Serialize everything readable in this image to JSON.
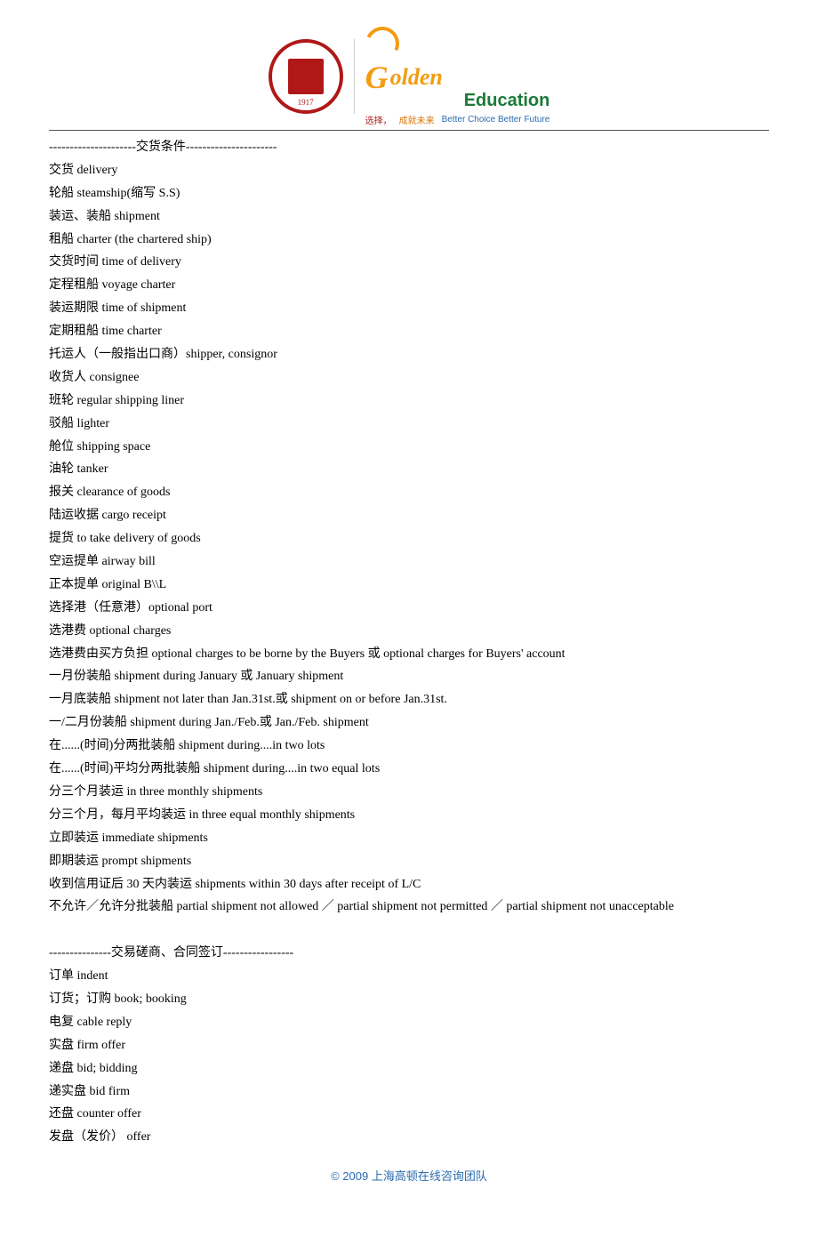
{
  "header": {
    "brand_g": "G",
    "brand_rest": "olden",
    "brand_sub": "Education",
    "tagline_cn1": "选择，",
    "tagline_cn2": "成就未来",
    "tagline_en": "Better Choice  Better Future",
    "seal_year": "1917"
  },
  "sections": [
    {
      "title": "---------------------交货条件----------------------",
      "lines": [
        "交货 delivery",
        "轮船 steamship(缩写 S.S)",
        "装运、装船 shipment",
        "租船 charter (the chartered ship)",
        "交货时间  time of delivery",
        "定程租船 voyage charter",
        "装运期限 time of shipment",
        "定期租船 time charter",
        "托运人（一般指出口商）shipper, consignor",
        "收货人 consignee",
        "班轮 regular shipping liner",
        "驳船 lighter",
        "舱位 shipping space",
        "油轮 tanker",
        "报关 clearance of goods",
        "陆运收据 cargo receipt",
        "提货 to take delivery of goods",
        "空运提单 airway bill",
        "正本提单 original B\\\\L",
        "选择港（任意港）optional port",
        "选港费 optional charges",
        "选港费由买方负担  optional charges to be borne by the Buyers  或  optional charges for Buyers'   account",
        "一月份装船  shipment during January  或  January shipment",
        "一月底装船  shipment not later than Jan.31st.或 shipment on or before Jan.31st.",
        "一/二月份装船  shipment during Jan./Feb.或  Jan./Feb. shipment",
        "在......(时间)分两批装船  shipment during....in two lots",
        "在......(时间)平均分两批装船  shipment during....in two equal lots",
        "分三个月装运  in three monthly shipments",
        "分三个月，每月平均装运  in three equal monthly shipments",
        "立即装运  immediate shipments",
        "即期装运  prompt shipments",
        "收到信用证后 30 天内装运  shipments within 30 days after receipt of L/C",
        "不允许／允许分批装船  partial shipment not allowed ／ partial shipment not permitted ／ partial shipment not unacceptable"
      ]
    },
    {
      "title": "---------------交易磋商、合同签订-----------------",
      "lines": [
        "订单  indent",
        "订货；订购  book; booking",
        "电复  cable reply",
        "实盘  firm offer",
        "递盘  bid; bidding",
        "递实盘  bid firm",
        "还盘  counter offer",
        "发盘（发价）  offer"
      ]
    }
  ],
  "footer": "© 2009 上海高顿在线咨询团队"
}
